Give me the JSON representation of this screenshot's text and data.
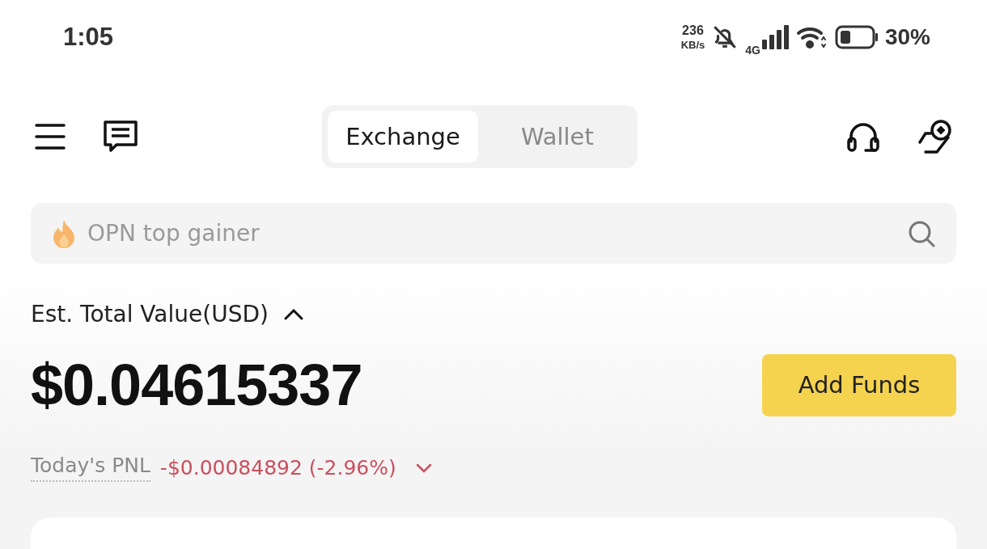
{
  "status_bar": {
    "time": "1:05",
    "speed_value": "236",
    "speed_unit": "KB/s",
    "network": "4G",
    "battery": "30%"
  },
  "top_bar": {
    "tabs": [
      {
        "label": "Exchange",
        "selected": true
      },
      {
        "label": "Wallet",
        "selected": false
      }
    ]
  },
  "search": {
    "placeholder": "OPN top gainer"
  },
  "balance": {
    "label": "Est. Total Value(USD)",
    "expanded": true,
    "amount": "$0.04615337",
    "add_funds": "Add Funds",
    "pnl_label": "Today's PNL",
    "pnl_value": "-$0.00084892 (-2.96%)"
  }
}
